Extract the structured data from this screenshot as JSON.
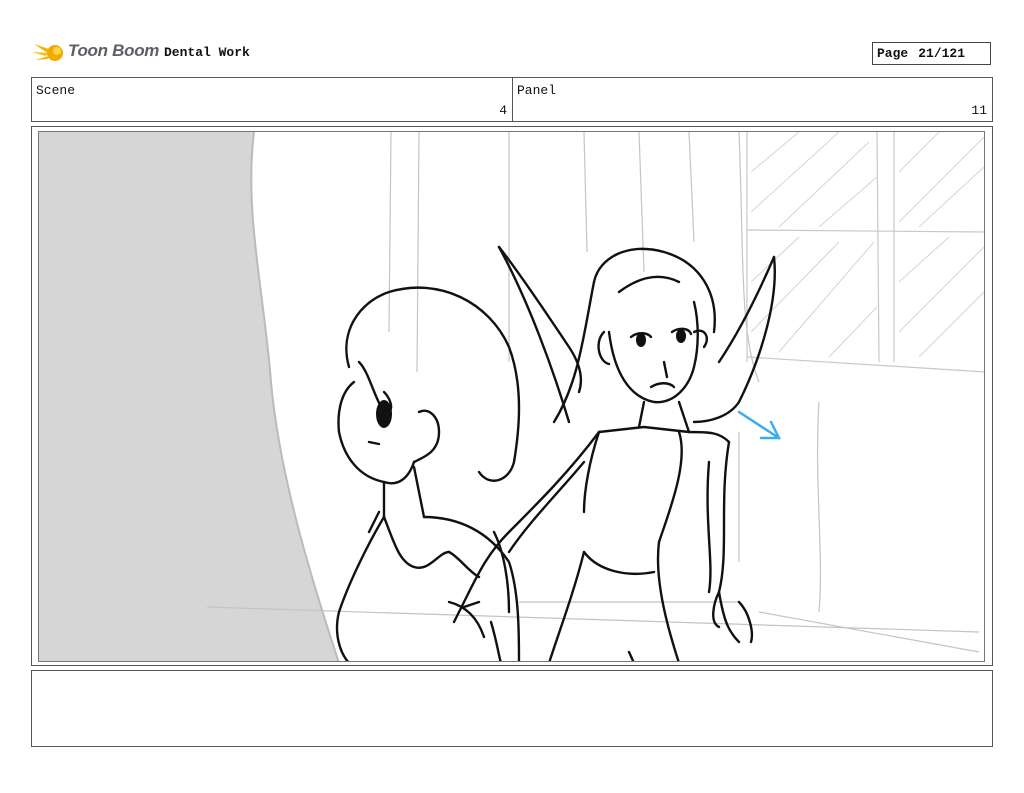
{
  "header": {
    "logo_text": "Toon Boom",
    "project_title": "Dental Work",
    "page_label": "Page",
    "page_value": "21/121"
  },
  "info": {
    "scene_label": "Scene",
    "scene_value": "4",
    "panel_label": "Panel",
    "panel_value": "11"
  },
  "panel_image": {
    "description_icon": "storyboard-sketch",
    "accent_color": "#3aaee8"
  },
  "notes": {
    "text": ""
  }
}
